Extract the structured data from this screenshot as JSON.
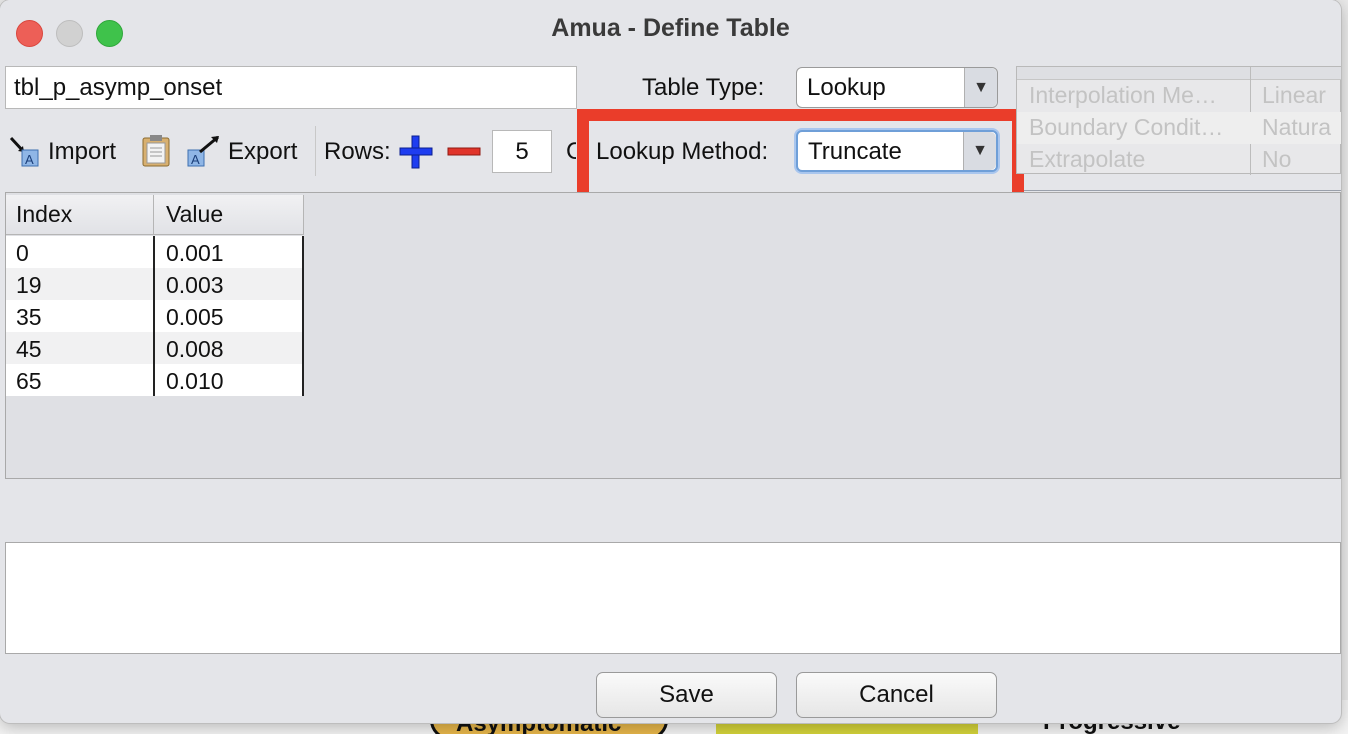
{
  "window": {
    "title": "Amua - Define Table",
    "traffic_lights": {
      "close": "#ed5f57",
      "minimize": "#d1d1d1",
      "maximize": "#3fc24b"
    }
  },
  "table_name": {
    "value": "tbl_p_asymp_onset"
  },
  "table_type": {
    "label": "Table Type:",
    "value": "Lookup"
  },
  "lookup_method": {
    "label": "Lookup Method:",
    "value": "Truncate",
    "highlight_color": "#ea3d2a"
  },
  "toolbar": {
    "import_label": "Import",
    "export_label": "Export",
    "rows_label": "Rows:",
    "rows_value": "5",
    "clipped_label": "C"
  },
  "options_table": {
    "rows": [
      {
        "name": "Interpolation Me…",
        "value": "Linear"
      },
      {
        "name": "Boundary Condit…",
        "value": "Natura"
      },
      {
        "name": "Extrapolate",
        "value": "No"
      }
    ]
  },
  "data_table": {
    "headers": [
      "Index",
      "Value"
    ],
    "rows": [
      [
        "0",
        "0.001"
      ],
      [
        "19",
        "0.003"
      ],
      [
        "35",
        "0.005"
      ],
      [
        "45",
        "0.008"
      ],
      [
        "65",
        "0.010"
      ]
    ]
  },
  "notes": {
    "value": ""
  },
  "buttons": {
    "save": "Save",
    "cancel": "Cancel"
  },
  "background_app": {
    "left_node": "Asymptomatic",
    "right_node": "Progressive"
  },
  "colors": {
    "add_icon": "#1e3df0",
    "remove_icon": "#e0342a",
    "window_bg": "#e4e5e9"
  }
}
